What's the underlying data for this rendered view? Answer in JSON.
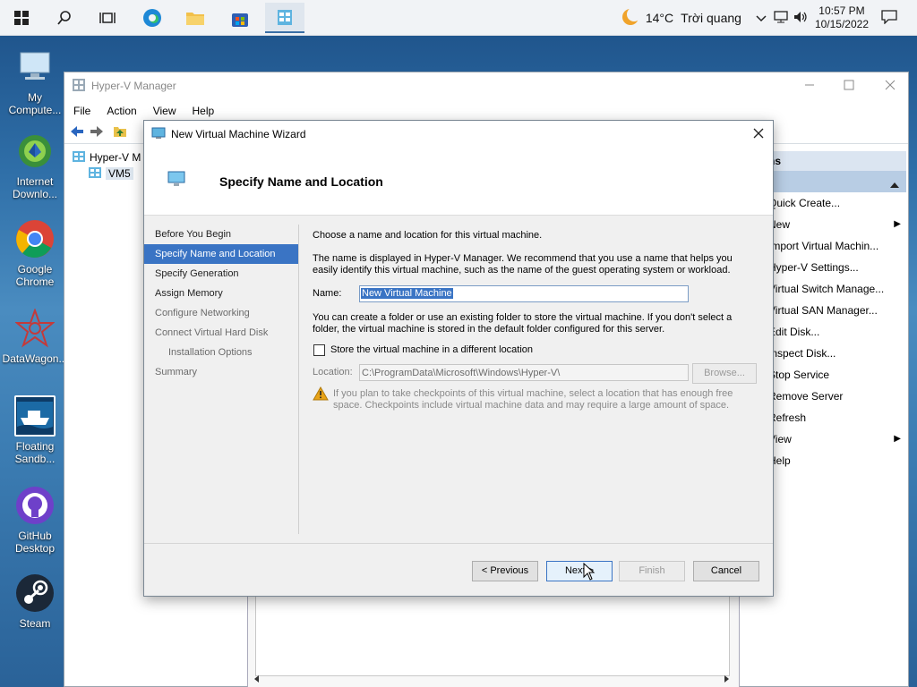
{
  "taskbar": {
    "weather_temp": "14°C",
    "weather_text": "Trời quang",
    "time": "10:57 PM",
    "date": "10/15/2022"
  },
  "desktop_icons": [
    {
      "label": "My Compute..."
    },
    {
      "label": "Internet Downlo..."
    },
    {
      "label": "Google Chrome"
    },
    {
      "label": "DataWagon..."
    },
    {
      "label": "Floating Sandb..."
    },
    {
      "label": "GitHub Desktop"
    },
    {
      "label": "Steam"
    }
  ],
  "hyperv": {
    "title": "Hyper-V Manager",
    "menu": [
      "File",
      "Action",
      "View",
      "Help"
    ],
    "tree_root": "Hyper-V M",
    "tree_child": "VM5",
    "actions_header": "ns",
    "actions": [
      {
        "label": "Quick Create...",
        "submenu": false
      },
      {
        "label": "New",
        "submenu": true
      },
      {
        "label": "Import Virtual Machin...",
        "submenu": false
      },
      {
        "label": "Hyper-V Settings...",
        "submenu": false
      },
      {
        "label": "Virtual Switch Manage...",
        "submenu": false
      },
      {
        "label": "Virtual SAN Manager...",
        "submenu": false
      },
      {
        "label": "Edit Disk...",
        "submenu": false
      },
      {
        "label": "Inspect Disk...",
        "submenu": false
      },
      {
        "label": "Stop Service",
        "submenu": false
      },
      {
        "label": "Remove Server",
        "submenu": false
      },
      {
        "label": "Refresh",
        "submenu": false
      },
      {
        "label": "View",
        "submenu": true
      },
      {
        "label": "Help",
        "submenu": false
      }
    ]
  },
  "wizard": {
    "title": "New Virtual Machine Wizard",
    "heading": "Specify Name and Location",
    "nav": [
      {
        "label": "Before You Begin",
        "state": "normal"
      },
      {
        "label": "Specify Name and Location",
        "state": "selected"
      },
      {
        "label": "Specify Generation",
        "state": "normal"
      },
      {
        "label": "Assign Memory",
        "state": "normal"
      },
      {
        "label": "Configure Networking",
        "state": "dim"
      },
      {
        "label": "Connect Virtual Hard Disk",
        "state": "dim"
      },
      {
        "label": "Installation Options",
        "state": "dim-indent"
      },
      {
        "label": "Summary",
        "state": "dim"
      }
    ],
    "intro": "Choose a name and location for this virtual machine.",
    "desc": "The name is displayed in Hyper-V Manager. We recommend that you use a name that helps you easily identify this virtual machine, such as the name of the guest operating system or workload.",
    "name_label": "Name:",
    "name_value": "New Virtual Machine",
    "folder_desc": "You can create a folder or use an existing folder to store the virtual machine. If you don't select a folder, the virtual machine is stored in the default folder configured for this server.",
    "checkbox_label": "Store the virtual machine in a different location",
    "checkbox_checked": false,
    "location_label": "Location:",
    "location_value": "C:\\ProgramData\\Microsoft\\Windows\\Hyper-V\\",
    "browse_label": "Browse...",
    "warning": "If you plan to take checkpoints of this virtual machine, select a location that has enough free space. Checkpoints include virtual machine data and may require a large amount of space.",
    "buttons": {
      "previous": "< Previous",
      "next": "Next >",
      "finish": "Finish",
      "cancel": "Cancel"
    }
  },
  "colors": {
    "accent": "#3a74c4",
    "warning": "#e8a317"
  }
}
